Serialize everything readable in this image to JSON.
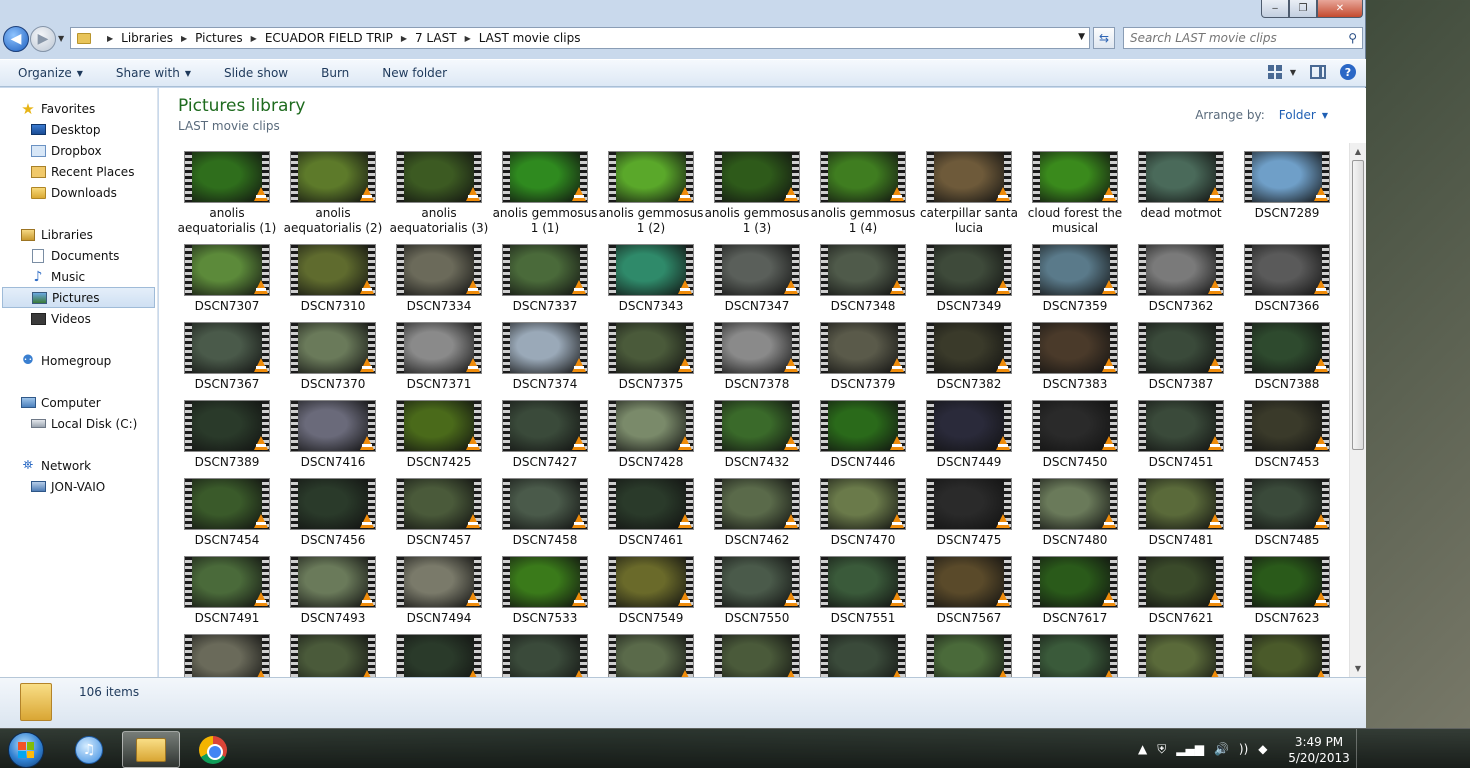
{
  "window": {
    "caption": {
      "min": "‒",
      "max": "❐",
      "close": "✕"
    }
  },
  "address": {
    "crumbs": [
      "Libraries",
      "Pictures",
      "ECUADOR FIELD TRIP",
      "7 LAST",
      "LAST movie clips"
    ],
    "search_placeholder": "Search LAST movie clips"
  },
  "toolbar": {
    "organize": "Organize",
    "share_with": "Share with",
    "slide_show": "Slide show",
    "burn": "Burn",
    "new_folder": "New folder"
  },
  "nav": {
    "favorites": "Favorites",
    "favorites_items": [
      "Desktop",
      "Dropbox",
      "Recent Places",
      "Downloads"
    ],
    "libraries": "Libraries",
    "libraries_items": [
      "Documents",
      "Music",
      "Pictures",
      "Videos"
    ],
    "selected": "Pictures",
    "homegroup": "Homegroup",
    "computer": "Computer",
    "computer_items": [
      "Local Disk (C:)"
    ],
    "network": "Network",
    "network_items": [
      "JON-VAIO"
    ]
  },
  "content": {
    "title": "Pictures library",
    "subtitle": "LAST movie clips",
    "arrange_label": "Arrange by:",
    "arrange_value": "Folder"
  },
  "files": [
    {
      "name": "anolis aequatorialis (1)",
      "color": "#2f6e1c"
    },
    {
      "name": "anolis aequatorialis (2)",
      "color": "#5d7a2a"
    },
    {
      "name": "anolis aequatorialis (3)",
      "color": "#3c5a22"
    },
    {
      "name": "anolis gemmosus 1 (1)",
      "color": "#2f8a1f"
    },
    {
      "name": "anolis gemmosus 1 (2)",
      "color": "#5aa82a"
    },
    {
      "name": "anolis gemmosus 1 (3)",
      "color": "#2e5a1a"
    },
    {
      "name": "anolis gemmosus 1 (4)",
      "color": "#3f7d20"
    },
    {
      "name": "caterpillar santa lucia",
      "color": "#6e5a3a"
    },
    {
      "name": "cloud forest the musical",
      "color": "#3a8a1c"
    },
    {
      "name": "dead motmot",
      "color": "#4a6a5a"
    },
    {
      "name": "DSCN7289",
      "color": "#6f9fc8"
    },
    {
      "name": "DSCN7307",
      "color": "#5c8a3a"
    },
    {
      "name": "DSCN7310",
      "color": "#5f6b2e"
    },
    {
      "name": "DSCN7334",
      "color": "#6b6a5a"
    },
    {
      "name": "DSCN7337",
      "color": "#4a6a3a"
    },
    {
      "name": "DSCN7343",
      "color": "#2f8a6a"
    },
    {
      "name": "DSCN7347",
      "color": "#5a5f5a"
    },
    {
      "name": "DSCN7348",
      "color": "#4f5a4a"
    },
    {
      "name": "DSCN7349",
      "color": "#3e4a3a"
    },
    {
      "name": "DSCN7359",
      "color": "#5a7a8a"
    },
    {
      "name": "DSCN7362",
      "color": "#7a7a7a"
    },
    {
      "name": "DSCN7366",
      "color": "#5a5a5a"
    },
    {
      "name": "DSCN7367",
      "color": "#4a5a4a"
    },
    {
      "name": "DSCN7370",
      "color": "#6a7a5a"
    },
    {
      "name": "DSCN7371",
      "color": "#8a8a8a"
    },
    {
      "name": "DSCN7374",
      "color": "#9aa9b8"
    },
    {
      "name": "DSCN7375",
      "color": "#4a5a3a"
    },
    {
      "name": "DSCN7378",
      "color": "#8a8a8a"
    },
    {
      "name": "DSCN7379",
      "color": "#5a5a4a"
    },
    {
      "name": "DSCN7382",
      "color": "#3a3a2a"
    },
    {
      "name": "DSCN7383",
      "color": "#4a3a2a"
    },
    {
      "name": "DSCN7387",
      "color": "#3a4a3a"
    },
    {
      "name": "DSCN7388",
      "color": "#2e4a2e"
    },
    {
      "name": "DSCN7389",
      "color": "#2a3a2a"
    },
    {
      "name": "DSCN7416",
      "color": "#6a6a7a"
    },
    {
      "name": "DSCN7425",
      "color": "#4a6a1a"
    },
    {
      "name": "DSCN7427",
      "color": "#3a4a3a"
    },
    {
      "name": "DSCN7428",
      "color": "#7a8a6a"
    },
    {
      "name": "DSCN7432",
      "color": "#3a6a2a"
    },
    {
      "name": "DSCN7446",
      "color": "#2a6a1a"
    },
    {
      "name": "DSCN7449",
      "color": "#2a2a3a"
    },
    {
      "name": "DSCN7450",
      "color": "#2a2a2a"
    },
    {
      "name": "DSCN7451",
      "color": "#3a4a3a"
    },
    {
      "name": "DSCN7453",
      "color": "#3a3a2a"
    },
    {
      "name": "DSCN7454",
      "color": "#3a5a2a"
    },
    {
      "name": "DSCN7456",
      "color": "#2a3a2a"
    },
    {
      "name": "DSCN7457",
      "color": "#4a5a3a"
    },
    {
      "name": "DSCN7458",
      "color": "#4a5a4a"
    },
    {
      "name": "DSCN7461",
      "color": "#2a3a2a"
    },
    {
      "name": "DSCN7462",
      "color": "#5a6a4a"
    },
    {
      "name": "DSCN7470",
      "color": "#6a7a4a"
    },
    {
      "name": "DSCN7475",
      "color": "#2a2a2a"
    },
    {
      "name": "DSCN7480",
      "color": "#6a7a5a"
    },
    {
      "name": "DSCN7481",
      "color": "#5a6a3a"
    },
    {
      "name": "DSCN7485",
      "color": "#3a4a3a"
    },
    {
      "name": "DSCN7491",
      "color": "#4a6a3a"
    },
    {
      "name": "DSCN7493",
      "color": "#6a7a5a"
    },
    {
      "name": "DSCN7494",
      "color": "#7a7a6a"
    },
    {
      "name": "DSCN7533",
      "color": "#3a7a1a"
    },
    {
      "name": "DSCN7549",
      "color": "#6a6a2a"
    },
    {
      "name": "DSCN7550",
      "color": "#4a5a4a"
    },
    {
      "name": "DSCN7551",
      "color": "#3a5a3a"
    },
    {
      "name": "DSCN7567",
      "color": "#5a4a2a"
    },
    {
      "name": "DSCN7617",
      "color": "#2a5a1a"
    },
    {
      "name": "DSCN7621",
      "color": "#3a4a2a"
    },
    {
      "name": "DSCN7623",
      "color": "#2a5a1a"
    },
    {
      "name": "",
      "color": "#6a6a5a"
    },
    {
      "name": "",
      "color": "#4a5a3a"
    },
    {
      "name": "",
      "color": "#2a3a2a"
    },
    {
      "name": "",
      "color": "#3a4a3a"
    },
    {
      "name": "",
      "color": "#5a6a4a"
    },
    {
      "name": "",
      "color": "#4a5a3a"
    },
    {
      "name": "",
      "color": "#3a4a3a"
    },
    {
      "name": "",
      "color": "#4a6a3a"
    },
    {
      "name": "",
      "color": "#3a5a3a"
    },
    {
      "name": "",
      "color": "#5a6a3a"
    },
    {
      "name": "",
      "color": "#4a5a2a"
    }
  ],
  "status": {
    "count": "106 items"
  },
  "clock": {
    "time": "3:49 PM",
    "date": "5/20/2013"
  }
}
